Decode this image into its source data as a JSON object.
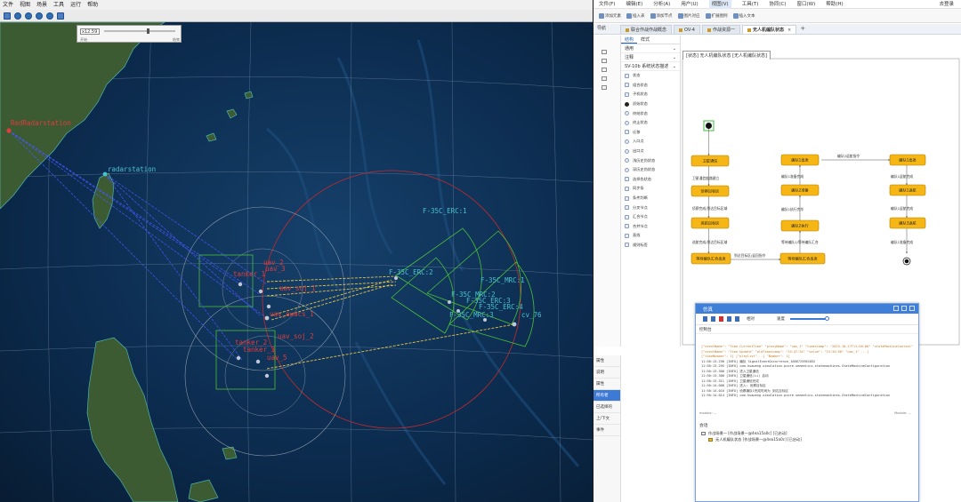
{
  "left_app": {
    "menus": [
      "文件",
      "视图",
      "场景",
      "工具",
      "运行",
      "帮助"
    ],
    "time_panel": {
      "time_value": "x12.59",
      "labels": [
        "开始",
        "结束"
      ]
    },
    "map": {
      "labels": {
        "red_radar": "RedRadarstation",
        "radar": "radarstation",
        "f35c_erc1": "F-35C_ERC:1",
        "f35c_erc2": "F-35C_ERC:2",
        "f35c_mrc1": "F-35C_MRC:1",
        "f35c_mrc2": "F-35C_MRC:2",
        "f35c_erc3": "F-35C_ERC:3",
        "f35c_erc4": "F-35C_ERC:4",
        "f35c_mrc3": "F-35C_MRC:3",
        "cv76": "cv_76",
        "tanker1": "tanker_1",
        "uav2": "uav_2",
        "uav3": "uav_3",
        "uav_soj1": "uav_soj_1",
        "awacs": "uav_awacs_1",
        "uav_soj2": "uav_soj_2",
        "tanker2": "tanker_2",
        "tanker3": "tanker_3",
        "uav5": "uav_5"
      },
      "colors": {
        "ocean_deep": "#0a2948",
        "land": "#3c5a34",
        "red_label": "#e23b3b",
        "cyan_label": "#49c2cf",
        "green_zone": "#54c23a",
        "blue_link": "#4a5cff",
        "yellow_link": "#e8c54a"
      }
    }
  },
  "right_app": {
    "menus": [
      "文件(F)",
      "编辑(E)",
      "分析(A)",
      "用户(U)",
      "视图(V)",
      "工具(T)",
      "协同(C)",
      "窗口(W)",
      "帮助(H)"
    ],
    "active_menu": "视图(V)",
    "login": "去登录",
    "toolbar": [
      "添加元素",
      "插入表",
      "添加节点",
      "图片对应",
      "扩展图例",
      "插入文本"
    ],
    "nav_label": "导航",
    "tabs": [
      {
        "label": "联合作战作战概念"
      },
      {
        "label": "OV-4"
      },
      {
        "label": "作战资源一"
      },
      {
        "label": "无人机编队状态"
      }
    ],
    "new_tab": "+",
    "palette": {
      "tabs": [
        "结构",
        "样式"
      ],
      "sections": [
        "通用",
        "注释",
        "SV-10b 系统状态描述"
      ],
      "items": [
        "状态",
        "组合状态",
        "子机状态",
        "初始状态",
        "终结状态",
        "终止状态",
        "迁移",
        "入口点",
        "出口点",
        "浅历史伪状态",
        "深历史伪状态",
        "选择伪状态",
        "同步条",
        "条件判断",
        "分叉节点",
        "汇合节点",
        "合并节点",
        "直线",
        "规则标签"
      ]
    },
    "diagram": {
      "header": "[状态] 无人机编队状态 [无人机编队状态]",
      "states": {
        "s_sat_comm": "卫星通信",
        "s_pre_control": "编队1出发",
        "s_recon1": "侦察目标区",
        "s_recon2": "巡航目标区",
        "s_wait": "等待编队汇合出发",
        "s_f1_fly": "编队1起飞",
        "s_f2_fly": "编队2准备",
        "s_f2_exec": "编队2执行",
        "s_f2_result": "等待编队汇合出发",
        "s_r1": "编队1出发",
        "s_r2": "编队1返航",
        "s_r3": "编队3返航"
      },
      "transitions": {
        "t1": "卫星通信链路建立",
        "t2": "侦察完成/到达目标区域",
        "t3": "巡航完成/到达目标区域",
        "t4": "等待编队1汇合完成",
        "t5": "到达目标区/返回指令",
        "t6": "编队1准备完成",
        "t7": "编队1准备完成",
        "t8": "编队1执行完毕",
        "t9": "等待编队1/等待编队汇合",
        "t10": "编队2返航指令",
        "t11": "编队1返航完成",
        "t12": "编队1返航完成"
      }
    },
    "props": {
      "items": [
        "属性",
        "说明",
        "属性",
        "所有者",
        "已选择的",
        "上/下文",
        "事件"
      ],
      "active_index": 3
    },
    "sim": {
      "title": "仿真",
      "speed_label": "速度",
      "fixed_label": "相对",
      "console_label": "控制台",
      "log": [
        {
          "text": "  [\"eventName\": \"Time.CurrentTime\" \"proxyName\": \"uav_1\" \"timestamp\": \"2023-10-17T11:56:00\" \"stateMachineContext\": {}]",
          "level": "warn"
        },
        {
          "text": "  [\"eventName\": \"Time.Update\" \"oldTimestamp\": \"15:47:34\" \"value\": \"13:34:50\" \"uav_1\" ...]",
          "level": "warn"
        },
        {
          "text": "  [\"timeNumber\": 1] [\"playlist\"...] \"Number\": 1]",
          "level": "warn"
        },
        {
          "text": "11:50:13.290 [INFO] 编队 SignalEventOccurrence_1686725961852",
          "level": "info"
        },
        {
          "text": "11:50:13.295 [INFO] com.huaweng.simulation.pcore.semantics.statemachines.StateMachineConfiguration",
          "level": "info"
        },
        {
          "text": "11:50:13.300 [INFO] 进入卫星通信",
          "level": "info"
        },
        {
          "text": "11:50:13.306 [INFO] 卫星通信(ii) 启动",
          "level": "info"
        },
        {
          "text": "11:50:13.311 [INFO] 卫星通信完成",
          "level": "info"
        },
        {
          "text": "11:50:14.008 [INFO] 进入: 侦察目标区",
          "level": "info"
        },
        {
          "text": "11:50:14.010 [INFO] 侦察编队1完成时间为 到达目标区",
          "level": "info"
        },
        {
          "text": "11:50:14.014 [INFO] com.huaweng.simulation.pcore.semantics.statemachines.StateMachineConfiguration",
          "level": "info"
        }
      ],
      "status_left": "module: ...",
      "status_right": "Module: ...",
      "sessions_label": "会话",
      "sessions": [
        "作战场景一 [作战场景一@4ea15a0c] [已启动]",
        "无人机编队状态 [作战场景一@4ea15a0c] [已启动]"
      ]
    }
  }
}
